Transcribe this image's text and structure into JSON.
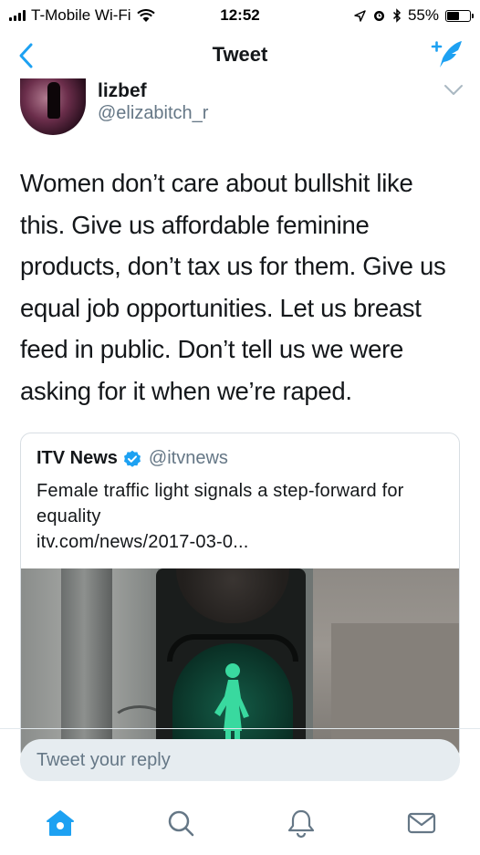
{
  "status_bar": {
    "carrier": "T-Mobile Wi-Fi",
    "time": "12:52",
    "battery": "55%",
    "battery_level": 0.55
  },
  "nav": {
    "title": "Tweet",
    "back_icon": "chevron-left-icon",
    "compose_icon": "compose-tweet-icon"
  },
  "tweet": {
    "display_name": "lizbef",
    "handle": "@elizabitch_r",
    "text": "Women don’t care about bullshit like this. Give us affordable feminine products, don’t tax us for them. Give us equal job opportunities. Let us breast feed in public. Don’t tell us we were asking for it when we’re raped."
  },
  "quoted_tweet": {
    "name": "ITV News",
    "handle": "@itvnews",
    "headline": "Female traffic light signals a step-forward for equality",
    "link": "itv.com/news/2017-03-0..."
  },
  "reply": {
    "placeholder": "Tweet your reply"
  },
  "tab_bar": {
    "items": [
      "home-icon",
      "search-icon",
      "notifications-icon",
      "messages-icon"
    ]
  },
  "colors": {
    "accent": "#1da1f2",
    "secondary_text": "#657786",
    "primary_text": "#14171a",
    "verified": "#1da1f2",
    "reply_bg": "#e6ecf0"
  }
}
